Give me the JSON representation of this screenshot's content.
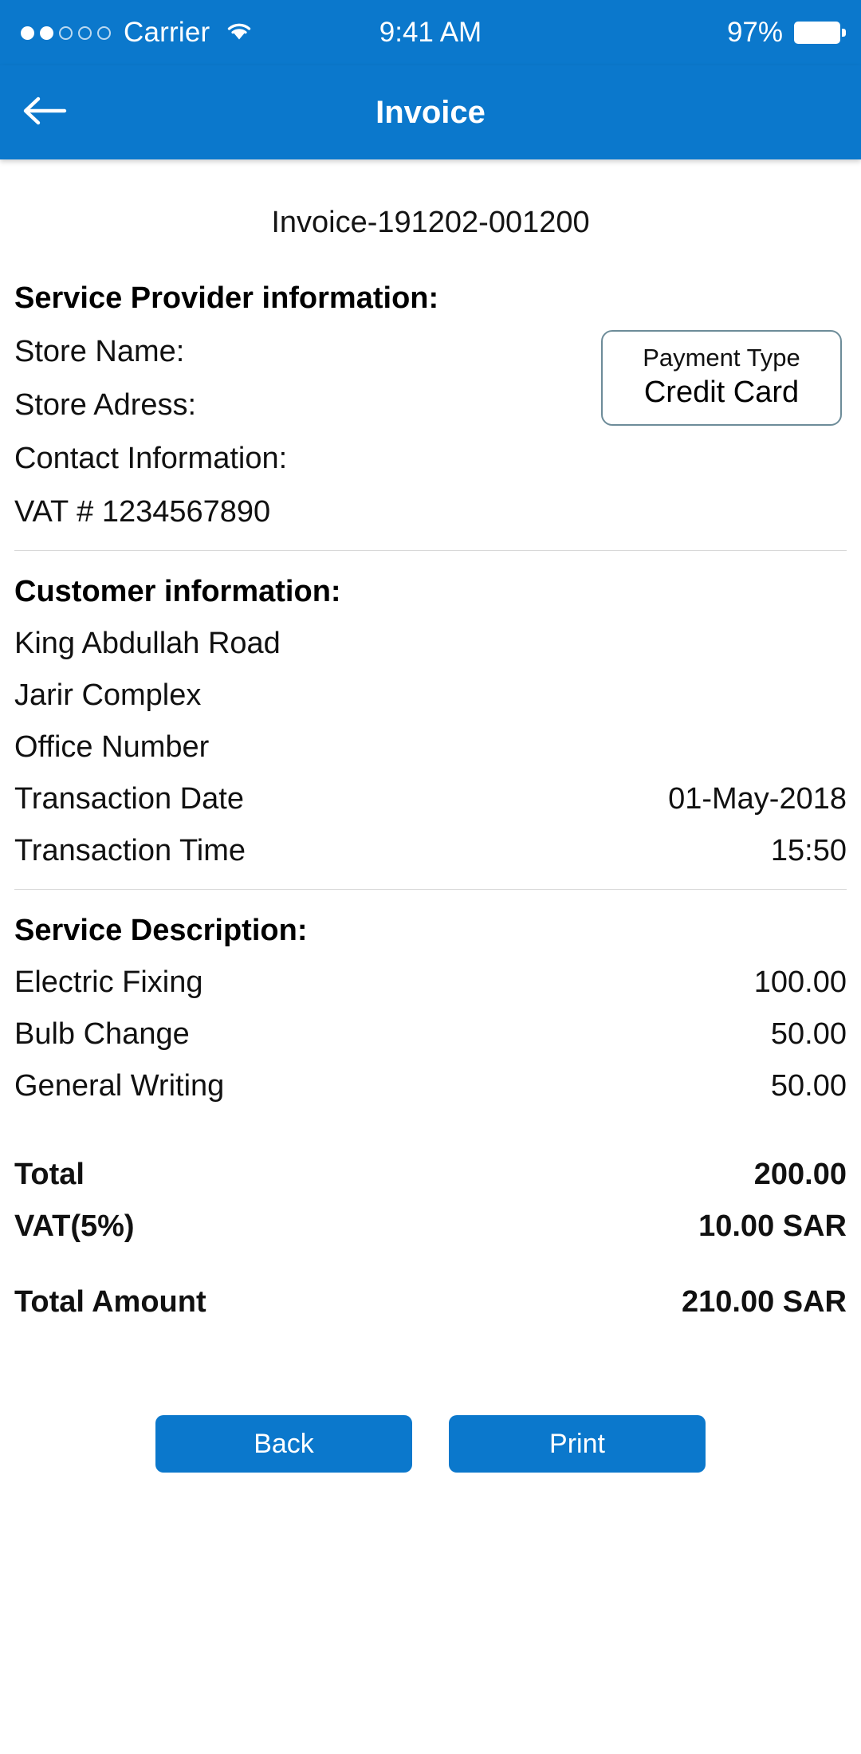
{
  "colors": {
    "header_blue": "#0B78CC",
    "button_blue": "#0B78CC",
    "divider_gray": "#d8d8d8",
    "payment_box_border": "#6d8c99"
  },
  "status_bar": {
    "carrier": "Carrier",
    "signal_filled_dots": 2,
    "signal_hollow_dots": 3,
    "wifi_icon": "wifi-icon",
    "time": "9:41 AM",
    "battery_percent": "97%",
    "battery_icon": "battery-full-icon"
  },
  "nav_bar": {
    "back_icon": "arrow-left-icon",
    "title": "Invoice"
  },
  "invoice": {
    "number": "Invoice-191202-001200"
  },
  "service_provider": {
    "title": "Service Provider information:",
    "lines": [
      {
        "label": "Store Name:",
        "value": ""
      },
      {
        "label": "Store Adress:",
        "value": ""
      },
      {
        "label": "Contact Information:",
        "value": ""
      },
      {
        "label": "VAT # 1234567890",
        "value": ""
      }
    ]
  },
  "payment_type": {
    "label": "Payment Type",
    "value": "Credit Card"
  },
  "customer": {
    "title": "Customer information:",
    "lines": [
      {
        "label": "King Abdullah Road",
        "value": ""
      },
      {
        "label": "Jarir Complex",
        "value": ""
      },
      {
        "label": "Office Number",
        "value": ""
      },
      {
        "label": "Transaction Date",
        "value": "01-May-2018"
      },
      {
        "label": "Transaction Time",
        "value": "15:50"
      }
    ]
  },
  "service_description": {
    "title": "Service Description:",
    "items": [
      {
        "label": "Electric Fixing",
        "value": "100.00"
      },
      {
        "label": "Bulb Change",
        "value": "50.00"
      },
      {
        "label": "General Writing",
        "value": "50.00"
      }
    ]
  },
  "totals": {
    "subtotal": {
      "label": "Total",
      "value": "200.00"
    },
    "vat": {
      "label": "VAT(5%)",
      "value": "10.00 SAR"
    },
    "total_amount": {
      "label": "Total Amount",
      "value": "210.00 SAR"
    }
  },
  "actions": {
    "back_label": "Back",
    "print_label": "Print"
  }
}
